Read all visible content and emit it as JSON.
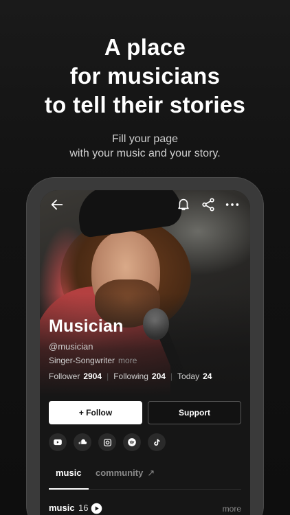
{
  "headline": {
    "line1": "A place",
    "line2": "for musicians",
    "line3": "to tell their stories"
  },
  "subline": {
    "line1": "Fill your page",
    "line2": "with your music and your story."
  },
  "profile": {
    "name": "Musician",
    "handle": "@musician",
    "role": "Singer-Songwriter",
    "role_more": "more",
    "stats": {
      "follower_label": "Follower",
      "follower_value": "2904",
      "following_label": "Following",
      "following_value": "204",
      "today_label": "Today",
      "today_value": "24"
    },
    "follow_label": "+ Follow",
    "support_label": "Support"
  },
  "socials": [
    "youtube-icon",
    "soundcloud-icon",
    "instagram-icon",
    "spotify-icon",
    "tiktok-icon"
  ],
  "tabs": {
    "music": "music",
    "community": "community",
    "community_ext": "↗"
  },
  "section": {
    "title": "music",
    "count": "16",
    "more": "more"
  },
  "colors": {
    "background": "#111111",
    "accent": "#ffffff",
    "shirt": "#c74b4b"
  }
}
